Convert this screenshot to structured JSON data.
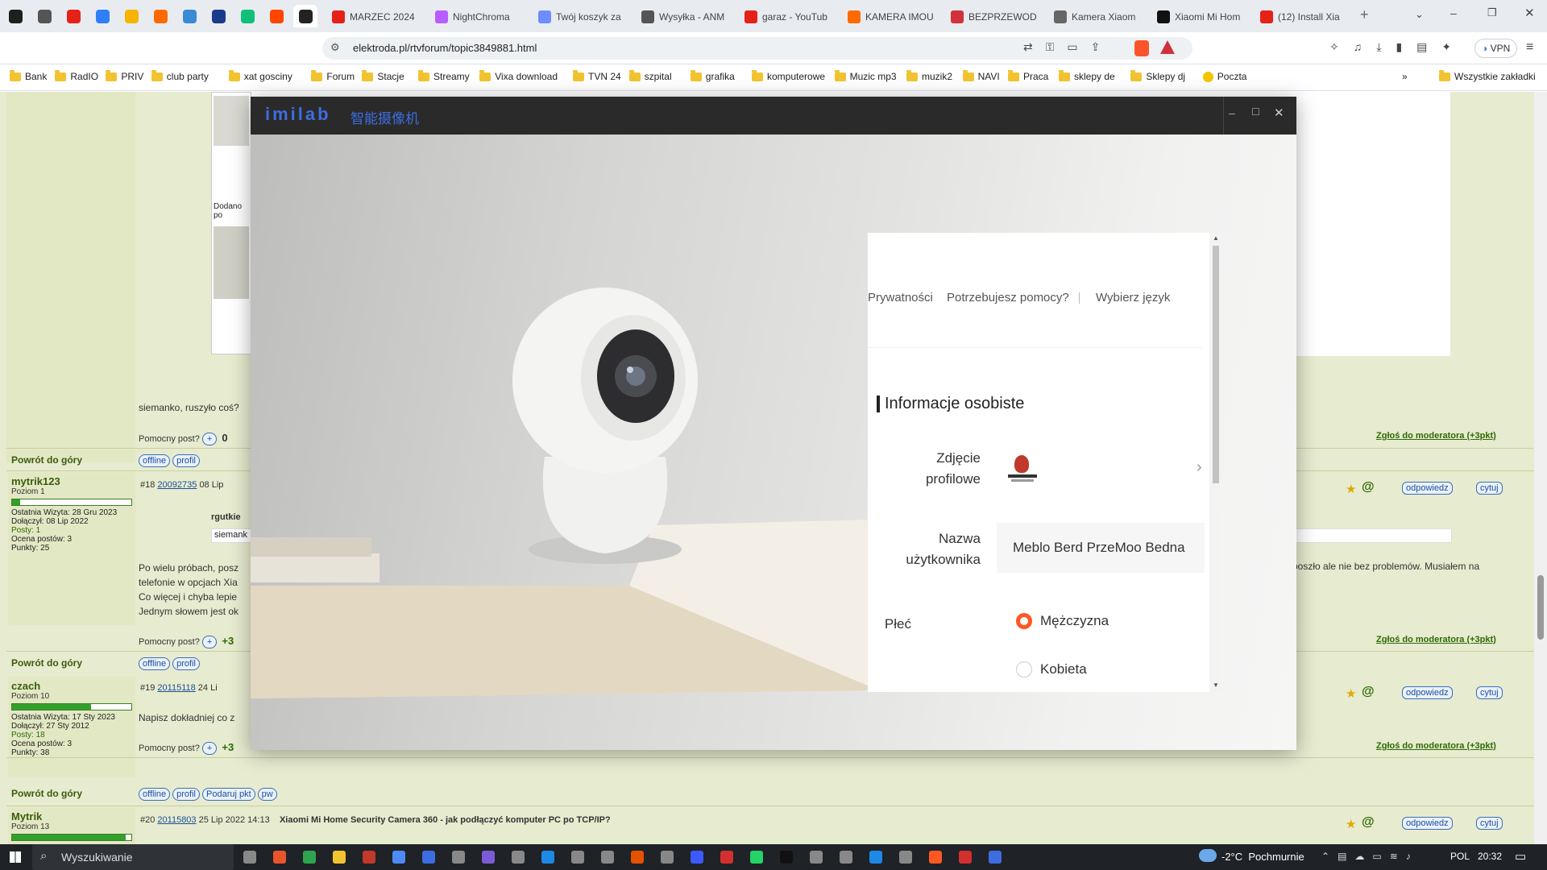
{
  "browser": {
    "tabs": [
      {
        "label": "MARZEC 2024",
        "color": "#e62117"
      },
      {
        "label": "NightChroma",
        "color": "#b95cff"
      },
      {
        "label": "Twój koszyk za",
        "color": "#6d8cff"
      },
      {
        "label": "Wysyłka - ANM",
        "color": "#555555"
      },
      {
        "label": "garaz - YouTub",
        "color": "#e62117"
      },
      {
        "label": "KAMERA IMOU",
        "color": "#ff6a00"
      },
      {
        "label": "BEZPRZEWOD",
        "color": "#d0313a"
      },
      {
        "label": "Kamera Xiaom",
        "color": "#666666"
      },
      {
        "label": "Xiaomi Mi Hom",
        "color": "#111111"
      },
      {
        "label": "(12) Install Xia",
        "color": "#e62117"
      }
    ],
    "pinned_tab_colors": [
      "#1f1f1f",
      "#555555",
      "#e62117",
      "#2f7ef5",
      "#f5b400",
      "#ff6a00",
      "#3b8ad6",
      "#1a3b8c",
      "#0fbf7a",
      "#ff4500",
      "#222222"
    ],
    "url": "elektroda.pl/rtvforum/topic3849881.html",
    "vpn_label": "VPN",
    "bookmarks": [
      "Bank",
      "RadIO",
      "PRIV",
      "club party",
      "xat gosciny",
      "Forum",
      "Stacje",
      "Streamy",
      "Vixa download",
      "TVN 24",
      "szpital",
      "grafika",
      "komputerowe",
      "Muzic mp3",
      "muzik2",
      "NAVI",
      "Praca",
      "sklepy de",
      "Sklepy dj",
      "Poczta"
    ],
    "all_bookmarks": "Wszystkie zakładki"
  },
  "forum": {
    "top_text": "Dodano po",
    "post0_text": "siemanko, ruszyło coś?",
    "pomocny": "Pomocny post?",
    "plus": "+",
    "zero": "0",
    "plus3": "+3",
    "report": "Zgłoś do moderatora (+3pkt)",
    "back_to_top": "Powrót do góry",
    "offline": "offline",
    "profil": "profil",
    "podaruj": "Podaruj pkt",
    "pw": "pw",
    "odpowiedz": "odpowiedz",
    "cytuj": "cytuj",
    "user1": {
      "name": "mytrik123",
      "level": "Poziom 1",
      "level_fraction": 0.07,
      "last": "Ostatnia Wizyta: 28 Gru 2023",
      "joined": "Dołączył: 08 Lip 2022",
      "posts": "Posty: 1",
      "rating": "Ocena postów: 3",
      "points": "Punkty: 25",
      "post_no": "#18",
      "post_id": "20092735",
      "date": "08 Lip",
      "quote_author": "rgutkie",
      "quote_text": "siemank",
      "body1": "Po wielu próbach, posz",
      "body1_end": "poszło ale nie bez problemów. Musiałem na",
      "body2": "telefonie w opcjach Xia",
      "body3": "Co więcej i chyba lepie",
      "body4": "Jednym słowem jest ok"
    },
    "user2": {
      "name": "czach",
      "level": "Poziom 10",
      "level_fraction": 0.66,
      "last": "Ostatnia Wizyta: 17 Sty 2023",
      "joined": "Dołączył: 27 Sty 2012",
      "posts": "Posty: 18",
      "rating": "Ocena postów: 3",
      "points": "Punkty: 38",
      "post_no": "#19",
      "post_id": "20115118",
      "date": "24 Li",
      "body": "Napisz dokładniej co z"
    },
    "user3": {
      "name": "Mytrik",
      "level": "Poziom 13",
      "level_fraction": 0.95,
      "post_no": "#20",
      "post_id": "20115803",
      "date": "25 Lip 2022 14:13",
      "title": "Xiaomi Mi Home Security Camera 360 - jak podłączyć komputer PC po TCP/IP?"
    }
  },
  "dialog": {
    "logo": "imilab",
    "logo_cn": "智能摄像机",
    "links": [
      "Prywatności",
      "Potrzebujesz pomocy?",
      "Wybierz język"
    ],
    "section_title": "Informacje osobiste",
    "photo_label": "Zdjęcie profilowe",
    "username_label": "Nazwa użytkownika",
    "username_value": "Meblo Berd PrzeMoo Bedna",
    "gender_label": "Płeć",
    "gender_options": [
      "Mężczyzna",
      "Kobieta"
    ],
    "gender_selected": "Mężczyzna",
    "accent": "#ff5722"
  },
  "taskbar": {
    "search_placeholder": "Wyszukiwanie",
    "weather": "-2°C  Pochmurnie",
    "lang": "POL",
    "time": "20:32"
  }
}
